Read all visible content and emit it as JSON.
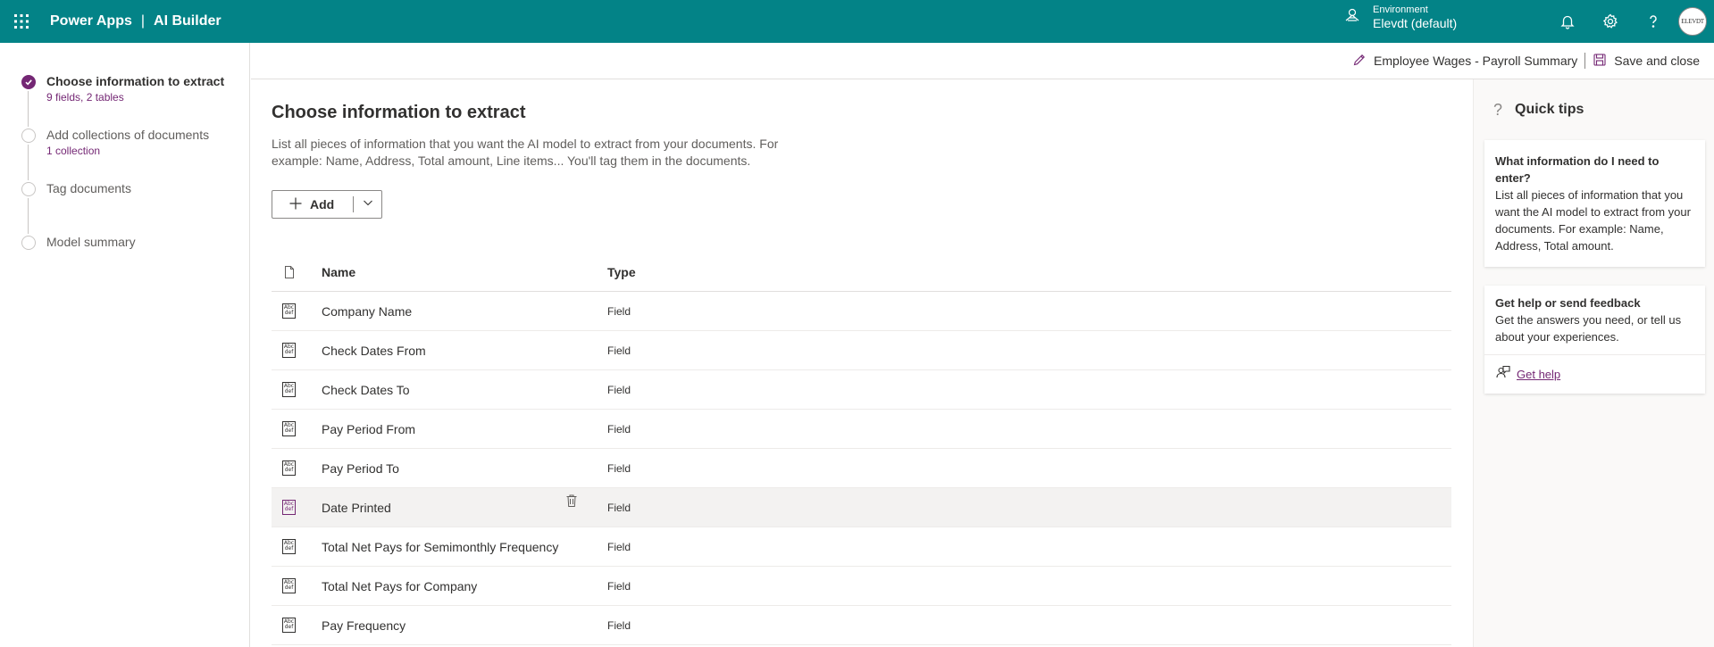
{
  "colors": {
    "brand": "#038387",
    "accent": "#742774"
  },
  "header": {
    "app_name": "Power Apps",
    "separator": "|",
    "product": "AI Builder",
    "environment_label": "Environment",
    "environment_name": "Elevdt (default)",
    "avatar_text": "ELEVDT"
  },
  "steps": [
    {
      "title": "Choose information to extract",
      "sub": "9 fields, 2 tables"
    },
    {
      "title": "Add collections of documents",
      "sub": "1 collection"
    },
    {
      "title": "Tag documents",
      "sub": ""
    },
    {
      "title": "Model summary",
      "sub": ""
    }
  ],
  "command_bar": {
    "model_name": "Employee Wages - Payroll Summary",
    "save_close": "Save and close"
  },
  "main": {
    "title": "Choose information to extract",
    "description": "List all pieces of information that you want the AI model to extract from your documents. For example: Name, Address, Total amount, Line items... You'll tag them in the documents.",
    "add_label": "Add",
    "columns": {
      "name": "Name",
      "type": "Type"
    },
    "rows": [
      {
        "name": "Company Name",
        "type": "Field"
      },
      {
        "name": "Check Dates From",
        "type": "Field"
      },
      {
        "name": "Check Dates To",
        "type": "Field"
      },
      {
        "name": "Pay Period From",
        "type": "Field"
      },
      {
        "name": "Pay Period To",
        "type": "Field"
      },
      {
        "name": "Date Printed",
        "type": "Field"
      },
      {
        "name": "Total Net Pays for Semimonthly Frequency",
        "type": "Field"
      },
      {
        "name": "Total Net Pays for Company",
        "type": "Field"
      },
      {
        "name": "Pay Frequency",
        "type": "Field"
      }
    ],
    "icon_text": "Abc def"
  },
  "tips": {
    "title": "Quick tips",
    "card1_heading": "What information do I need to enter?",
    "card1_body": "List all pieces of information that you want the AI model to extract from your documents. For example: Name, Address, Total amount.",
    "card2_heading": "Get help or send feedback",
    "card2_body": "Get the answers you need, or tell us about your experiences.",
    "get_help": "Get help"
  }
}
